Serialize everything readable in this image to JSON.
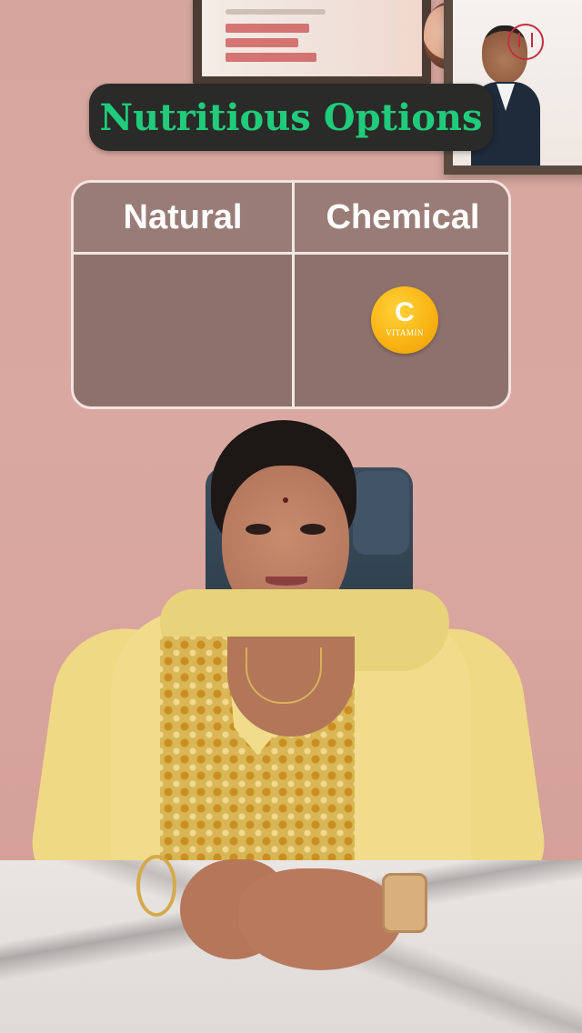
{
  "title": "Nutritious Options",
  "table": {
    "left_header": "Natural",
    "right_header": "Chemical"
  },
  "vitamin_badge": {
    "letter": "C",
    "label": "VITAMIN"
  },
  "colors": {
    "title_text": "#1fcc7b",
    "title_bg": "#2a2a28",
    "table_bg": "#8e716c",
    "wall": "#d6a69e",
    "badge": "#f9b514"
  }
}
